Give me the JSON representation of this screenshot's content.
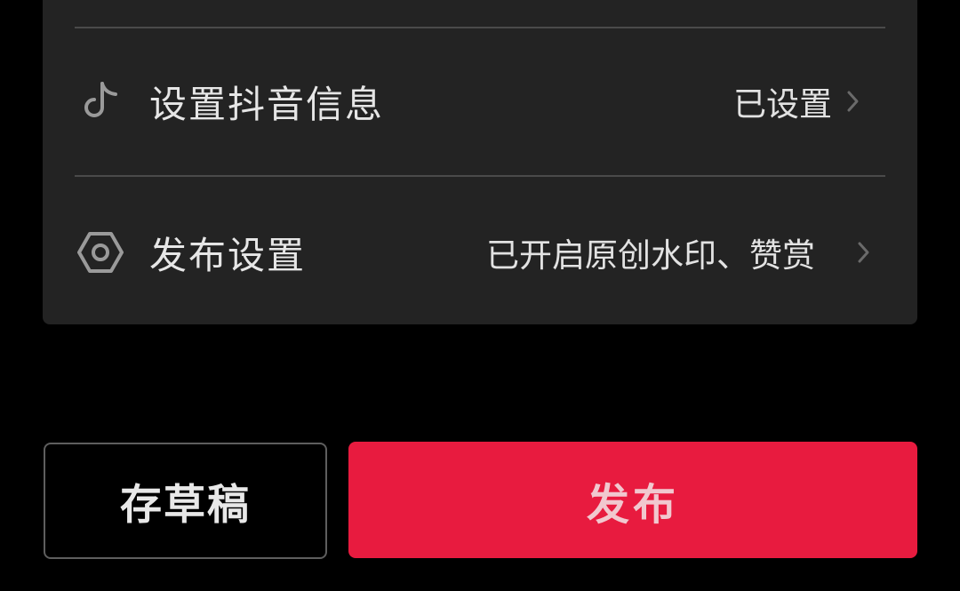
{
  "settings": {
    "douyin_row": {
      "label": "设置抖音信息",
      "value": "已设置",
      "icon": "tiktok-icon"
    },
    "publish_row": {
      "label": "发布设置",
      "value": "已开启原创水印、赞赏",
      "icon": "hexagon-gear-icon"
    }
  },
  "actions": {
    "draft_label": "存草稿",
    "publish_label": "发布"
  },
  "colors": {
    "background": "#000000",
    "panel": "#232323",
    "publish_accent": "#e81b3f"
  }
}
